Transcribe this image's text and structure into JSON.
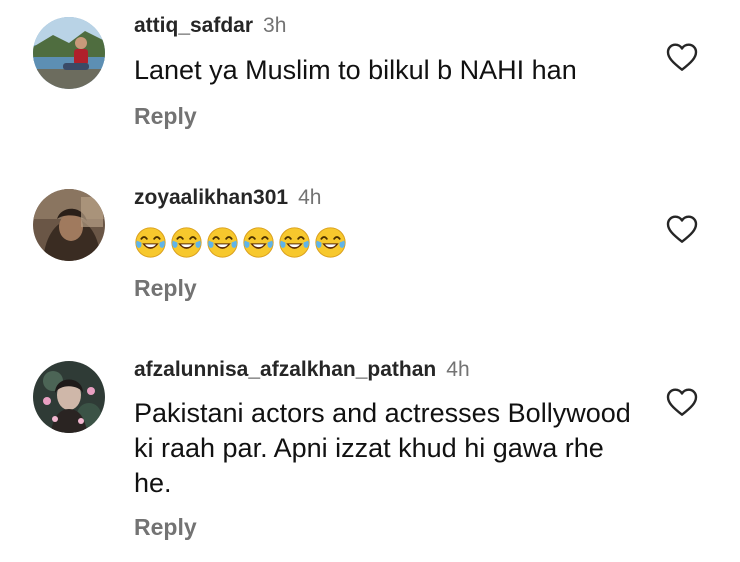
{
  "comments": [
    {
      "username": "attiq_safdar",
      "time": "3h",
      "text": "Lanet ya Muslim to bilkul b NAHI han",
      "reply_label": "Reply",
      "avatar_icon": "avatar-photo-man-lake",
      "like_icon": "heart-outline-icon"
    },
    {
      "username": "zoyaalikhan301",
      "time": "4h",
      "text": "",
      "emoji": [
        "😂",
        "😂",
        "😂",
        "😂",
        "😂",
        "😂"
      ],
      "emoji_name": "face-with-tears-of-joy",
      "reply_label": "Reply",
      "avatar_icon": "avatar-photo-dark-portrait",
      "like_icon": "heart-outline-icon"
    },
    {
      "username": "afzalunnisa_afzalkhan_pathan",
      "time": "4h",
      "text": "Pakistani actors and actresses Bollywood ki raah par. Apni izzat khud hi gawa rhe he.",
      "reply_label": "Reply",
      "avatar_icon": "avatar-photo-girl-flowers",
      "like_icon": "heart-outline-icon"
    }
  ],
  "colors": {
    "username": "#262626",
    "timestamp": "#737373",
    "reply": "#737373",
    "icon": "#262626",
    "background": "#ffffff"
  }
}
